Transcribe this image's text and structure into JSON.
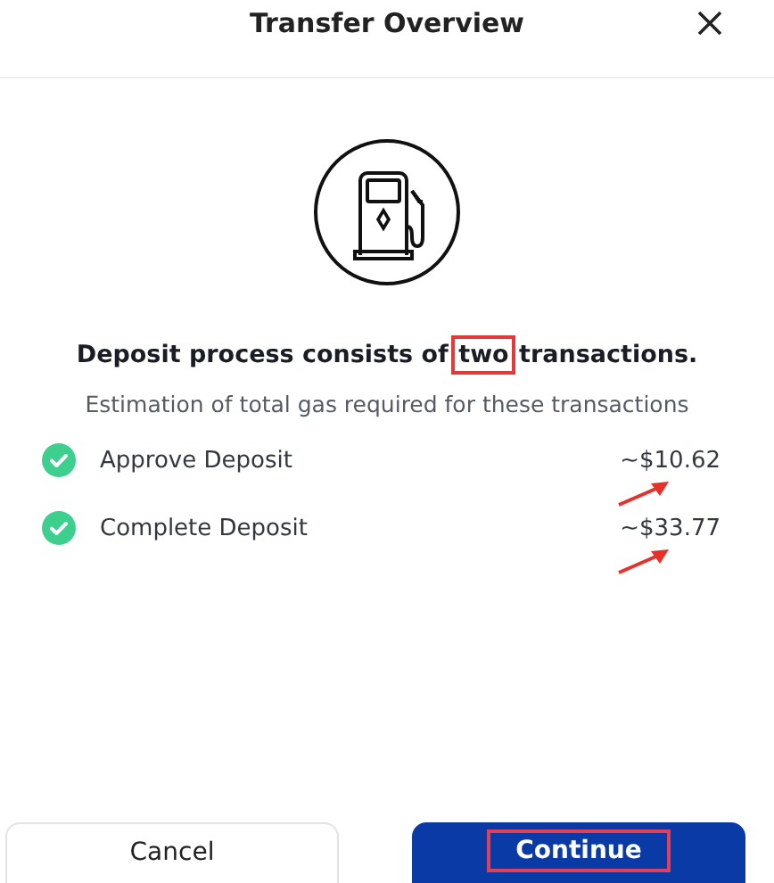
{
  "dialog": {
    "title": "Transfer Overview"
  },
  "heading": {
    "before": "Deposit process consists of",
    "marked": "two",
    "after": "transactions."
  },
  "subtitle": "Estimation of total gas required for these transactions",
  "steps": [
    {
      "label": "Approve Deposit",
      "amount": "~$10.62",
      "done": true,
      "annotated": true
    },
    {
      "label": "Complete Deposit",
      "amount": "~$33.77",
      "done": true,
      "annotated": true
    }
  ],
  "buttons": [
    {
      "label": "Cancel",
      "kind": "secondary",
      "annotated": false
    },
    {
      "label": "Continue",
      "kind": "primary",
      "annotated": true
    }
  ]
}
